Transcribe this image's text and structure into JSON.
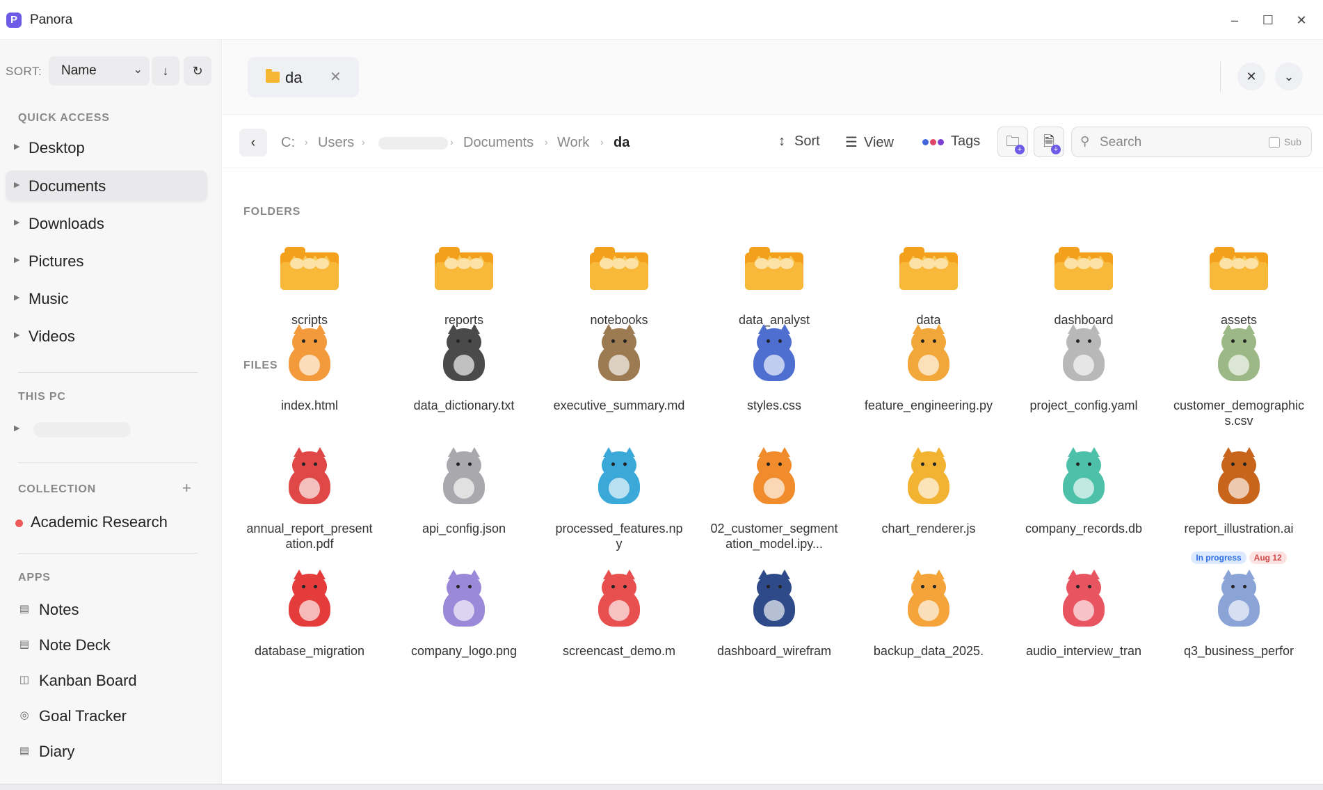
{
  "window": {
    "title": "Panora",
    "logo_letter": "P"
  },
  "sidebar": {
    "sort_label": "SORT:",
    "sort_value": "Name",
    "quick_access_header": "QUICK ACCESS",
    "quick_access": [
      "Desktop",
      "Documents",
      "Downloads",
      "Pictures",
      "Music",
      "Videos"
    ],
    "this_pc_header": "THIS PC",
    "collection_header": "COLLECTION",
    "collections": [
      {
        "label": "Academic Research",
        "color": "#ef5a5a"
      }
    ],
    "apps_header": "APPS",
    "apps": [
      "Notes",
      "Note Deck",
      "Kanban Board",
      "Goal Tracker",
      "Diary"
    ]
  },
  "tabs": [
    {
      "label": "da"
    }
  ],
  "breadcrumb": [
    "C:",
    "Users",
    "Documents",
    "Work",
    "da"
  ],
  "toolbar": {
    "sort": "Sort",
    "view": "View",
    "tags": "Tags"
  },
  "search": {
    "placeholder": "Search",
    "sub_label": "Sub"
  },
  "sections": {
    "folders": "FOLDERS",
    "files": "FILES"
  },
  "folders": [
    "scripts",
    "reports",
    "notebooks",
    "data_analyst",
    "data",
    "dashboard",
    "assets"
  ],
  "files": [
    {
      "name": "index.html",
      "color": "#f39a3c"
    },
    {
      "name": "data_dictionary.txt",
      "color": "#4a4a4a"
    },
    {
      "name": "executive_summary.md",
      "color": "#9c7a52"
    },
    {
      "name": "styles.css",
      "color": "#4f6fd0"
    },
    {
      "name": "feature_engineering.py",
      "color": "#f2a73a"
    },
    {
      "name": "project_config.yaml",
      "color": "#b8b8b8"
    },
    {
      "name": "customer_demographics.csv",
      "color": "#9cb886"
    },
    {
      "name": "annual_report_presentation.pdf",
      "color": "#e04848"
    },
    {
      "name": "api_config.json",
      "color": "#a9a9ad"
    },
    {
      "name": "processed_features.npy",
      "color": "#3aa8d8"
    },
    {
      "name": "02_customer_segmentation_model.ipy...",
      "color": "#f08c2c"
    },
    {
      "name": "chart_renderer.js",
      "color": "#f2b232"
    },
    {
      "name": "company_records.db",
      "color": "#4cc0a8"
    },
    {
      "name": "report_illustration.ai",
      "color": "#c8641c",
      "badges": [
        "In progress",
        "Aug 12"
      ]
    },
    {
      "name": "database_migration",
      "color": "#e43b3b"
    },
    {
      "name": "company_logo.png",
      "color": "#9a88d8"
    },
    {
      "name": "screencast_demo.m",
      "color": "#e85050"
    },
    {
      "name": "dashboard_wirefram",
      "color": "#2f4a88"
    },
    {
      "name": "backup_data_2025.",
      "color": "#f4a43a"
    },
    {
      "name": "audio_interview_tran",
      "color": "#e85560"
    },
    {
      "name": "q3_business_perfor",
      "color": "#8aa4d8"
    }
  ]
}
